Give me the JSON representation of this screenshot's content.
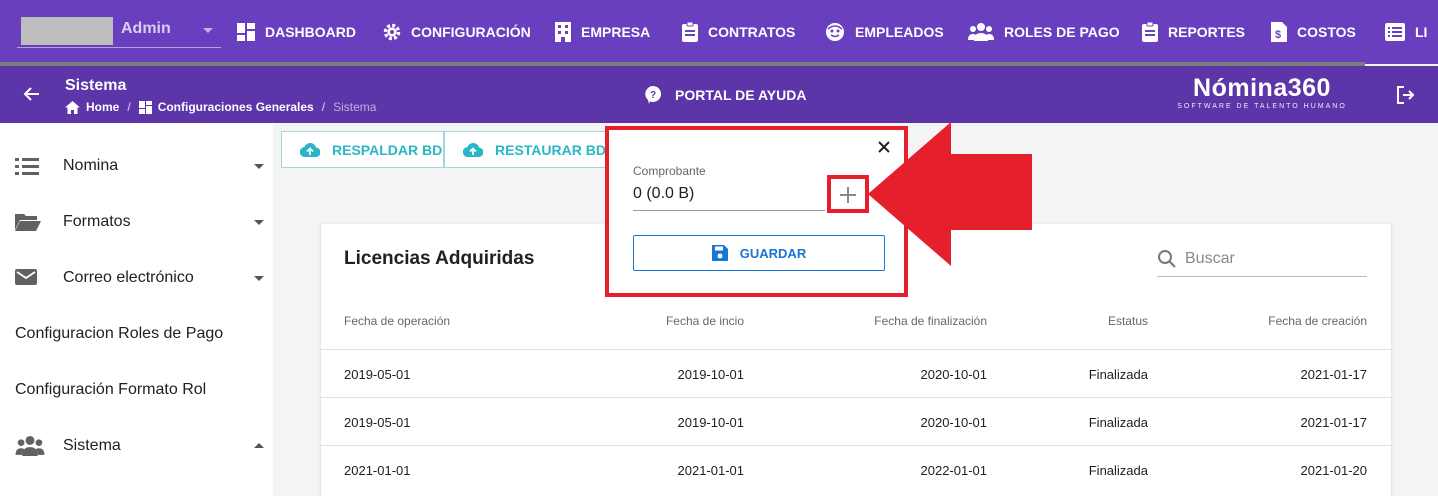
{
  "topnav": {
    "user": {
      "name": "Admin"
    },
    "items": [
      {
        "label": "DASHBOARD",
        "icon": "dashboard-icon"
      },
      {
        "label": "CONFIGURACIÓN",
        "icon": "gear-icon"
      },
      {
        "label": "EMPRESA",
        "icon": "building-icon"
      },
      {
        "label": "CONTRATOS",
        "icon": "clipboard-icon"
      },
      {
        "label": "EMPLEADOS",
        "icon": "face-icon"
      },
      {
        "label": "ROLES DE PAGO",
        "icon": "people-icon"
      },
      {
        "label": "REPORTES",
        "icon": "clipboard-icon"
      },
      {
        "label": "COSTOS",
        "icon": "document-dollar-icon"
      },
      {
        "label": "LI",
        "icon": "list-icon"
      }
    ]
  },
  "header": {
    "title": "Sistema",
    "breadcrumb": {
      "home": "Home",
      "section": "Configuraciones Generales",
      "current": "Sistema",
      "separator": "/"
    },
    "help": "PORTAL DE AYUDA",
    "brand": {
      "name": "Nómina360",
      "tagline": "SOFTWARE DE TALENTO HUMANO"
    }
  },
  "sidebar": {
    "items": [
      {
        "label": "Nomina",
        "icon": "list-icon"
      },
      {
        "label": "Formatos",
        "icon": "folder-open-icon"
      },
      {
        "label": "Correo electrónico",
        "icon": "mail-icon"
      },
      {
        "label": "Configuracion Roles de Pago"
      },
      {
        "label": "Configuración Formato Rol"
      },
      {
        "label": "Sistema",
        "icon": "people-icon"
      }
    ]
  },
  "actions": {
    "backup": "RESPALDAR BD",
    "restore": "RESTAURAR BD"
  },
  "card": {
    "title": "Licencias Adquiridas",
    "search_placeholder": "Buscar",
    "columns": [
      "Fecha de operación",
      "Fecha de incio",
      "Fecha de finalización",
      "Estatus",
      "Fecha de creación"
    ],
    "rows": [
      [
        "2019-05-01",
        "2019-10-01",
        "2020-10-01",
        "Finalizada",
        "2021-01-17"
      ],
      [
        "2019-05-01",
        "2019-10-01",
        "2020-10-01",
        "Finalizada",
        "2021-01-17"
      ],
      [
        "2021-01-01",
        "2021-01-01",
        "2022-01-01",
        "Finalizada",
        "2021-01-20"
      ]
    ]
  },
  "modal": {
    "field_label": "Comprobante",
    "field_value": "0 (0.0 B)",
    "save": "GUARDAR"
  },
  "colors": {
    "nav_bg": "#6a3fbf",
    "header_bg": "#5c35a8",
    "accent_teal": "#29b6c7",
    "primary_blue": "#1976d2",
    "highlight_red": "#e61f2c"
  }
}
